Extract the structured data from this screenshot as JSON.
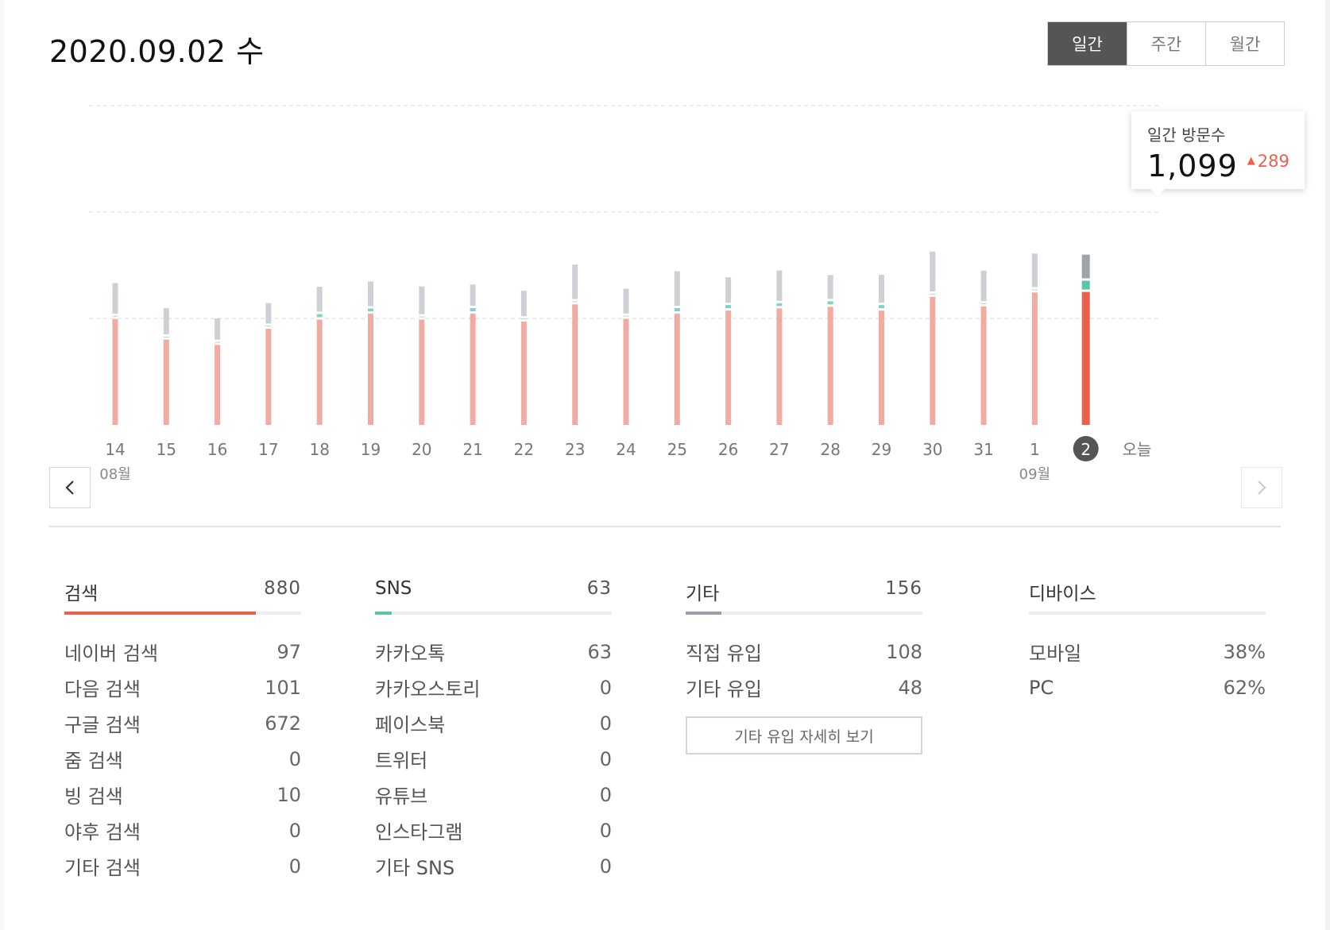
{
  "header": {
    "date_title": "2020.09.02 수",
    "period_tabs": [
      {
        "label": "일간",
        "active": true
      },
      {
        "label": "주간",
        "active": false
      },
      {
        "label": "월간",
        "active": false
      }
    ]
  },
  "tooltip": {
    "label": "일간 방문수",
    "value": "1,099",
    "delta": "289",
    "delta_color": "#ec5f4d"
  },
  "chart_data": {
    "type": "bar",
    "stacked": true,
    "categories": [
      "14",
      "15",
      "16",
      "17",
      "18",
      "19",
      "20",
      "21",
      "22",
      "23",
      "24",
      "25",
      "26",
      "27",
      "28",
      "29",
      "30",
      "31",
      "1",
      "2",
      "오늘"
    ],
    "month_labels": [
      {
        "category": "14",
        "label": "08월"
      },
      {
        "category": "1",
        "label": "09월"
      }
    ],
    "selected_category": "2",
    "series": [
      {
        "name": "검색",
        "color": "#ec5f4d",
        "values": [
          702,
          566,
          531,
          637,
          698,
          737,
          698,
          737,
          685,
          798,
          703,
          737,
          757,
          772,
          782,
          757,
          848,
          784,
          876,
          880,
          3
        ]
      },
      {
        "name": "SNS",
        "color": "#5ac5a9",
        "values": [
          9,
          9,
          9,
          9,
          26,
          23,
          9,
          26,
          9,
          9,
          9,
          26,
          26,
          23,
          26,
          26,
          9,
          9,
          9,
          63,
          0
        ]
      },
      {
        "name": "기타",
        "color": "#c7c9cc",
        "values": [
          201,
          173,
          140,
          134,
          163,
          163,
          183,
          140,
          167,
          227,
          163,
          226,
          167,
          200,
          157,
          183,
          262,
          201,
          221,
          156,
          0
        ]
      }
    ],
    "gridlines": [
      700,
      1400,
      2100
    ],
    "ylim": [
      0,
      2100
    ],
    "grid": true
  },
  "stats": [
    {
      "title": "검색",
      "total": "880",
      "bar_fraction": 0.81,
      "bar_color": "#ec5f4d",
      "rows": [
        {
          "label": "네이버 검색",
          "value": "97"
        },
        {
          "label": "다음 검색",
          "value": "101"
        },
        {
          "label": "구글 검색",
          "value": "672"
        },
        {
          "label": "줌 검색",
          "value": "0"
        },
        {
          "label": "빙 검색",
          "value": "10"
        },
        {
          "label": "야후 검색",
          "value": "0"
        },
        {
          "label": "기타 검색",
          "value": "0"
        }
      ]
    },
    {
      "title": "SNS",
      "total": "63",
      "bar_fraction": 0.07,
      "bar_color": "#5ac5a9",
      "rows": [
        {
          "label": "카카오톡",
          "value": "63"
        },
        {
          "label": "카카오스토리",
          "value": "0"
        },
        {
          "label": "페이스북",
          "value": "0"
        },
        {
          "label": "트위터",
          "value": "0"
        },
        {
          "label": "유튜브",
          "value": "0"
        },
        {
          "label": "인스타그램",
          "value": "0"
        },
        {
          "label": "기타 SNS",
          "value": "0"
        }
      ]
    },
    {
      "title": "기타",
      "total": "156",
      "bar_fraction": 0.15,
      "bar_color": "#9aa0a8",
      "rows": [
        {
          "label": "직접 유입",
          "value": "108"
        },
        {
          "label": "기타 유입",
          "value": "48"
        }
      ],
      "detail_button": "기타 유입 자세히 보기"
    },
    {
      "title": "디바이스",
      "total": "",
      "bar_fraction": 0,
      "bar_color": "#cccccc",
      "rows": [
        {
          "label": "모바일",
          "value": "38%"
        },
        {
          "label": "PC",
          "value": "62%"
        }
      ]
    }
  ],
  "icons": {
    "prev": "chevron-left-icon",
    "next": "chevron-right-icon",
    "delta_arrow": "caret-up-icon"
  }
}
